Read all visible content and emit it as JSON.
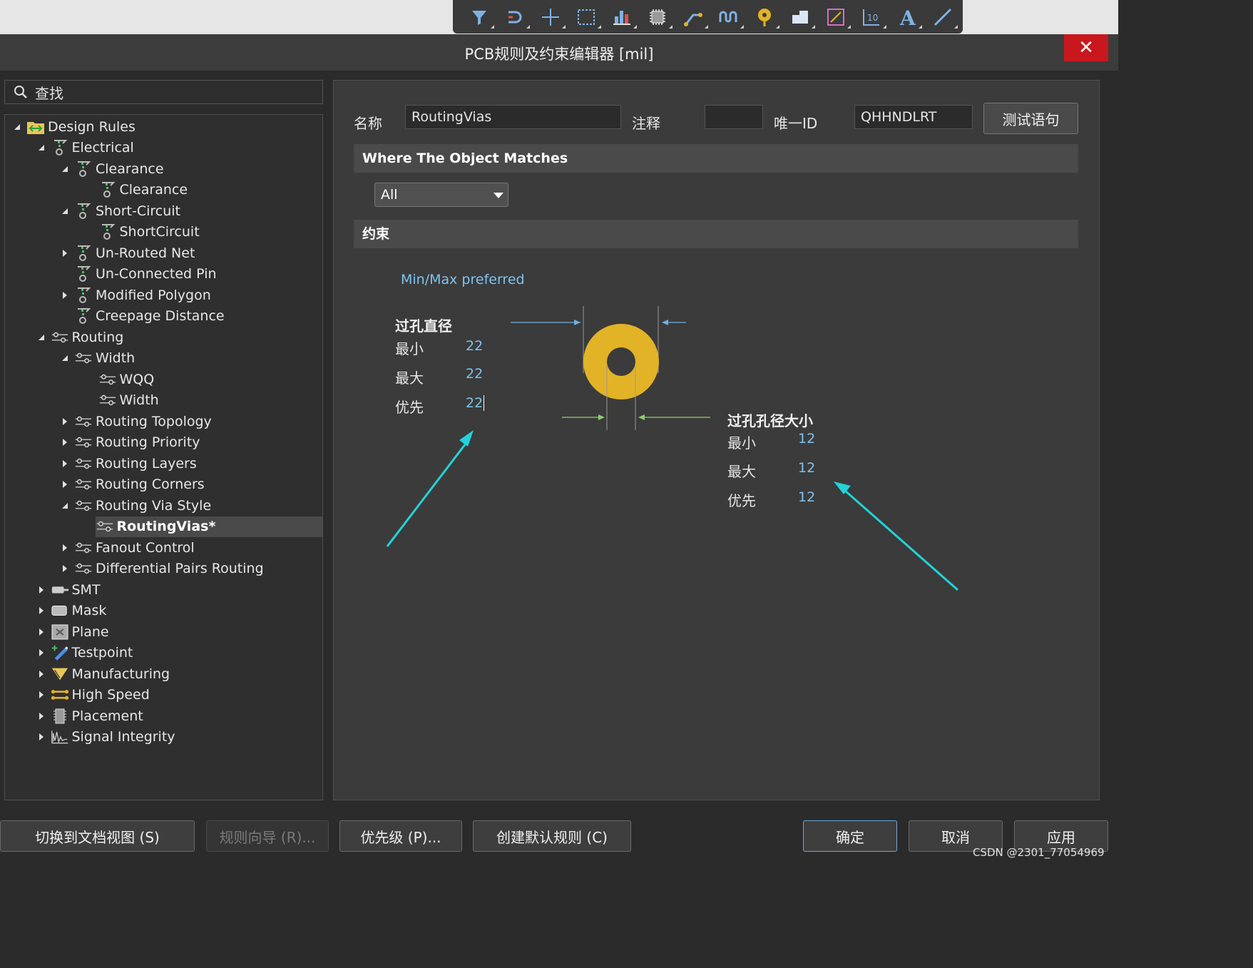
{
  "window": {
    "title": "PCB规则及约束编辑器 [mil]",
    "close_glyph": "✕"
  },
  "toolbar": {
    "icons": [
      "filter-icon",
      "interactive-routing-icon",
      "move-cross-icon",
      "select-rect-icon",
      "bar-align-icon",
      "chip-component-icon",
      "track-route-icon",
      "length-tune-icon",
      "via-pad-icon",
      "polygon-fill-icon",
      "measure-icon",
      "dimension-icon",
      "text-icon",
      "line-icon"
    ],
    "text_glyph": "A",
    "dim_glyph": "10"
  },
  "search": {
    "placeholder": "查找"
  },
  "tree": [
    {
      "label": "Design Rules",
      "level": 0,
      "expand": "open",
      "icon": "design-rules-icon"
    },
    {
      "label": "Electrical",
      "level": 1,
      "expand": "open",
      "icon": "electrical-icon"
    },
    {
      "label": "Clearance",
      "level": 2,
      "expand": "open",
      "icon": "electrical-icon"
    },
    {
      "label": "Clearance",
      "level": 3,
      "expand": "none",
      "icon": "electrical-icon"
    },
    {
      "label": "Short-Circuit",
      "level": 2,
      "expand": "open",
      "icon": "electrical-icon"
    },
    {
      "label": "ShortCircuit",
      "level": 3,
      "expand": "none",
      "icon": "electrical-icon"
    },
    {
      "label": "Un-Routed Net",
      "level": 2,
      "expand": "closed",
      "icon": "electrical-icon"
    },
    {
      "label": "Un-Connected Pin",
      "level": 2,
      "expand": "none",
      "icon": "electrical-icon"
    },
    {
      "label": "Modified Polygon",
      "level": 2,
      "expand": "closed",
      "icon": "electrical-icon"
    },
    {
      "label": "Creepage Distance",
      "level": 2,
      "expand": "none",
      "icon": "electrical-icon"
    },
    {
      "label": "Routing",
      "level": 1,
      "expand": "open",
      "icon": "routing-icon"
    },
    {
      "label": "Width",
      "level": 2,
      "expand": "open",
      "icon": "routing-icon"
    },
    {
      "label": "WQQ",
      "level": 3,
      "expand": "none",
      "icon": "routing-icon"
    },
    {
      "label": "Width",
      "level": 3,
      "expand": "none",
      "icon": "routing-icon"
    },
    {
      "label": "Routing Topology",
      "level": 2,
      "expand": "closed",
      "icon": "routing-icon"
    },
    {
      "label": "Routing Priority",
      "level": 2,
      "expand": "closed",
      "icon": "routing-icon"
    },
    {
      "label": "Routing Layers",
      "level": 2,
      "expand": "closed",
      "icon": "routing-icon"
    },
    {
      "label": "Routing Corners",
      "level": 2,
      "expand": "closed",
      "icon": "routing-icon"
    },
    {
      "label": "Routing Via Style",
      "level": 2,
      "expand": "open",
      "icon": "routing-icon"
    },
    {
      "label": "RoutingVias*",
      "level": 3,
      "expand": "none",
      "icon": "routing-icon",
      "selected": true
    },
    {
      "label": "Fanout Control",
      "level": 2,
      "expand": "closed",
      "icon": "routing-icon"
    },
    {
      "label": "Differential Pairs Routing",
      "level": 2,
      "expand": "closed",
      "icon": "routing-icon"
    },
    {
      "label": "SMT",
      "level": 1,
      "expand": "closed",
      "icon": "smt-icon"
    },
    {
      "label": "Mask",
      "level": 1,
      "expand": "closed",
      "icon": "mask-icon"
    },
    {
      "label": "Plane",
      "level": 1,
      "expand": "closed",
      "icon": "plane-icon"
    },
    {
      "label": "Testpoint",
      "level": 1,
      "expand": "closed",
      "icon": "testpoint-icon"
    },
    {
      "label": "Manufacturing",
      "level": 1,
      "expand": "closed",
      "icon": "manufacturing-icon"
    },
    {
      "label": "High Speed",
      "level": 1,
      "expand": "closed",
      "icon": "high-speed-icon"
    },
    {
      "label": "Placement",
      "level": 1,
      "expand": "closed",
      "icon": "placement-icon"
    },
    {
      "label": "Signal Integrity",
      "level": 1,
      "expand": "closed",
      "icon": "signal-integrity-icon"
    }
  ],
  "rule": {
    "name_label": "名称",
    "name_value": "RoutingVias",
    "comment_label": "注释",
    "comment_value": "",
    "uid_label": "唯一ID",
    "uid_value": "QHHNDLRT",
    "test_button": "测试语句",
    "where_header": "Where The Object Matches",
    "match_value": "All",
    "constraints_header": "约束",
    "mode_text": "Min/Max preferred"
  },
  "via_diameter": {
    "title": "过孔直径",
    "min_label": "最小",
    "min_value": "22",
    "max_label": "最大",
    "max_value": "22",
    "pref_label": "优先",
    "pref_value": "22"
  },
  "hole_size": {
    "title": "过孔孔径大小",
    "min_label": "最小",
    "min_value": "12",
    "max_label": "最大",
    "max_value": "12",
    "pref_label": "优先",
    "pref_value": "12"
  },
  "buttons": {
    "doc_view": "切换到文档视图 (S)",
    "wizard": "规则向导 (R)...",
    "priority": "优先级 (P)...",
    "create_default": "创建默认规则 (C)",
    "ok": "确定",
    "cancel": "取消",
    "apply": "应用"
  },
  "watermark": "CSDN @2301_77054969",
  "colors": {
    "via_ring": "#e2b327",
    "value_blue": "#7fc3f0",
    "arrow_cyan": "#22d3d9",
    "close_red": "#c8181e"
  }
}
